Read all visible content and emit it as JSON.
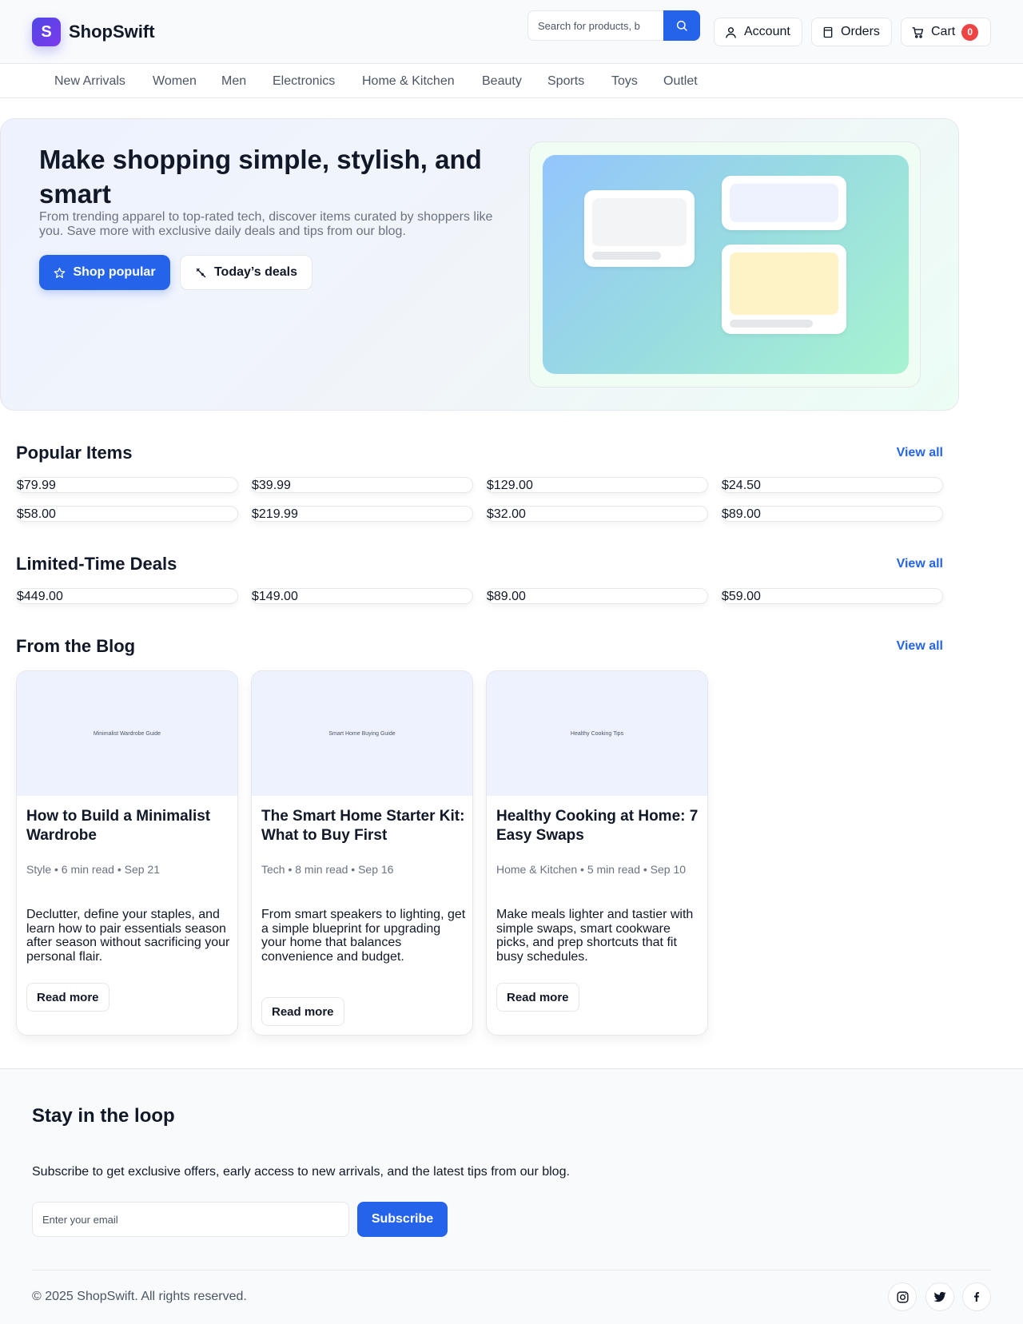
{
  "brand": {
    "mark": "S",
    "name": "ShopSwift"
  },
  "search": {
    "placeholder": "Search for products, b"
  },
  "header": {
    "account": "Account",
    "orders": "Orders",
    "cart": "Cart",
    "cart_count": "0"
  },
  "nav": [
    "New Arrivals",
    "Women",
    "Men",
    "Electronics",
    "Home & Kitchen",
    "Beauty",
    "Sports",
    "Toys",
    "Outlet"
  ],
  "hero": {
    "title": "Make shopping simple, stylish, and smart",
    "subtitle": "From trending apparel to top-rated tech, discover items curated by shoppers like you. Save more with exclusive daily deals and tips from our blog.",
    "primary_cta": "Shop popular",
    "secondary_cta": "Today’s deals"
  },
  "popular": {
    "title": "Popular Items",
    "view_all": "View all",
    "prices": [
      "$79.99",
      "$39.99",
      "$129.00",
      "$24.50",
      "$58.00",
      "$219.99",
      "$32.00",
      "$89.00"
    ]
  },
  "deals": {
    "title": "Limited-Time Deals",
    "view_all": "View all",
    "prices": [
      "$449.00",
      "$149.00",
      "$89.00",
      "$59.00"
    ]
  },
  "blog": {
    "title": "From the Blog",
    "view_all": "View all",
    "posts": [
      {
        "image_alt": "Minimalist Wardrobe Guide",
        "title": "How to Build a Minimalist Wardrobe",
        "meta": "Style • 6 min read • Sep 21",
        "excerpt": "Declutter, define your staples, and learn how to pair essentials season after season without sacrificing your personal flair.",
        "cta": "Read more"
      },
      {
        "image_alt": "Smart Home Buying Guide",
        "title": "The Smart Home Starter Kit: What to Buy First",
        "meta": "Tech • 8 min read • Sep 16",
        "excerpt": "From smart speakers to lighting, get a simple blueprint for upgrading your home that balances convenience and budget.",
        "cta": "Read more"
      },
      {
        "image_alt": "Healthy Cooking Tips",
        "title": "Healthy Cooking at Home: 7 Easy Swaps",
        "meta": "Home & Kitchen • 5 min read • Sep 10",
        "excerpt": "Make meals lighter and tastier with simple swaps, smart cookware picks, and prep shortcuts that fit busy schedules.",
        "cta": "Read more"
      }
    ]
  },
  "footer": {
    "title": "Stay in the loop",
    "text": "Subscribe to get exclusive offers, early access to new arrivals, and the latest tips from our blog.",
    "email_placeholder": "Enter your email",
    "subscribe": "Subscribe",
    "copyright": "© 2025 ShopSwift. All rights reserved.",
    "social": [
      "instagram-icon",
      "twitter-icon",
      "facebook-icon"
    ]
  },
  "colors": {
    "accent": "#2563eb",
    "badge": "#ef4444",
    "text": "#111827",
    "muted": "#6b7280"
  }
}
